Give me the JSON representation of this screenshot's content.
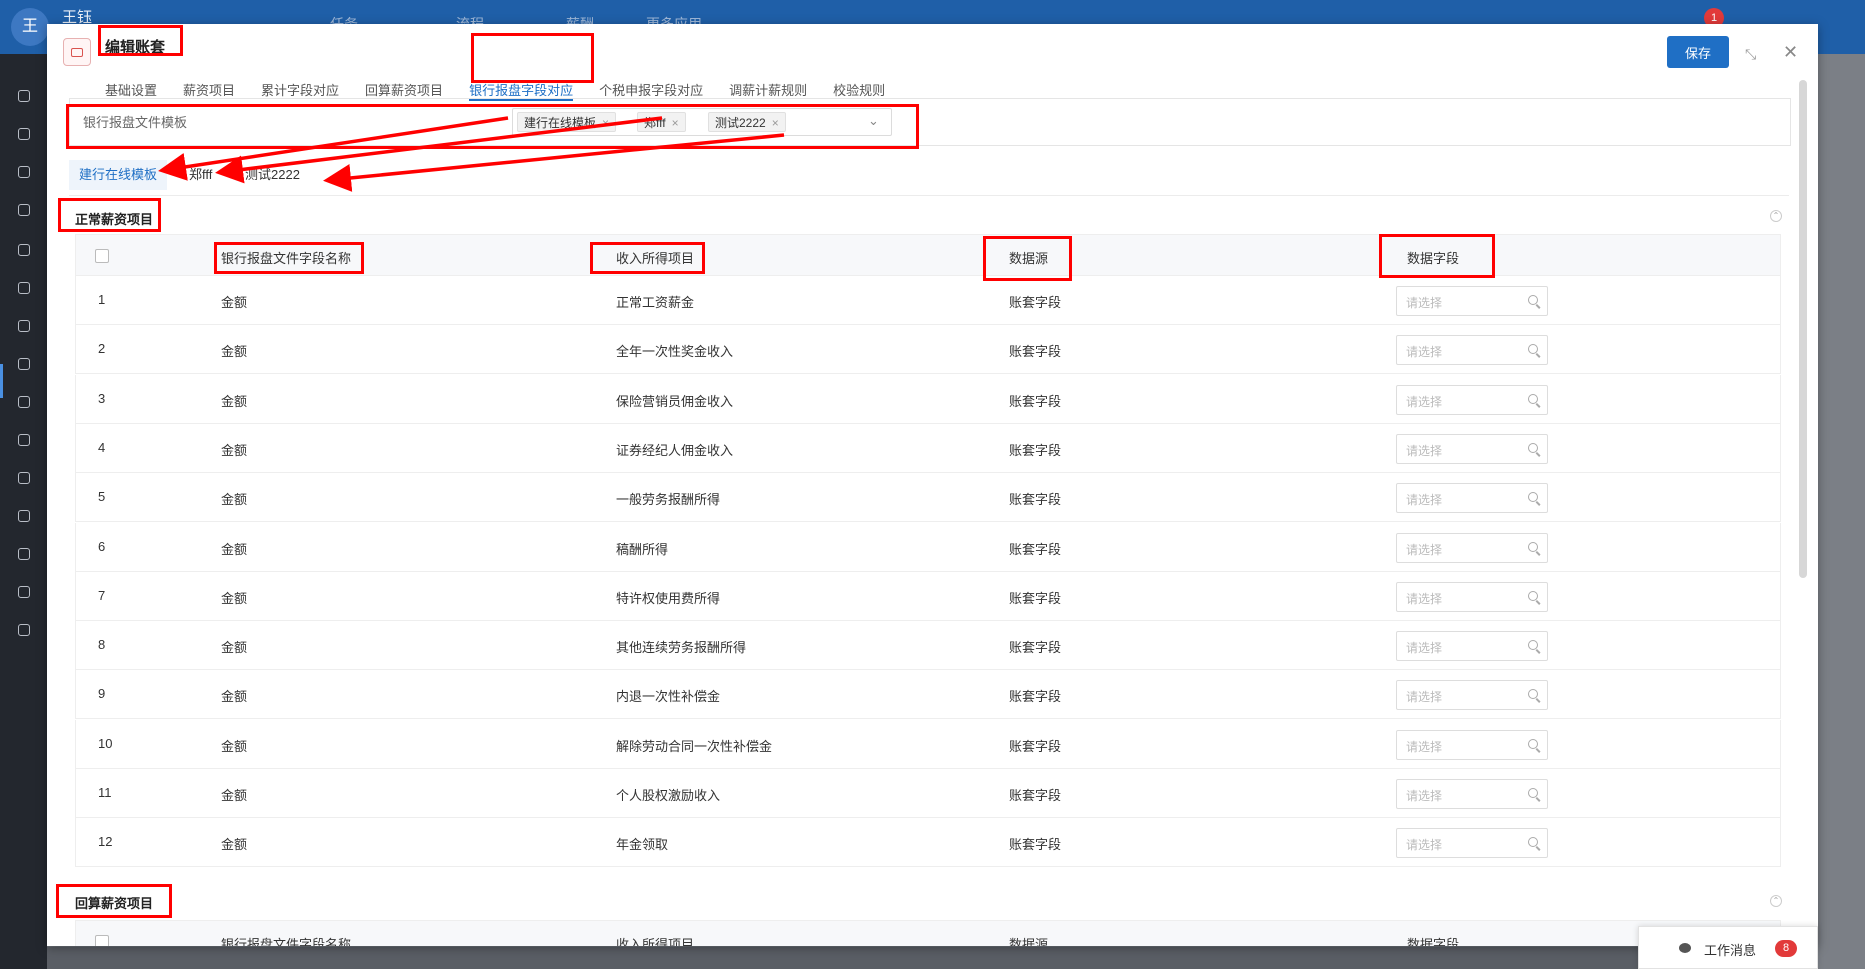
{
  "app": {
    "user_initial": "王",
    "user_name": "王钰",
    "notification_count": "1",
    "bg_tabs": [
      "任务",
      "流程",
      "薪酬",
      "更多应用"
    ]
  },
  "modal": {
    "title": "编辑账套",
    "save_label": "保存",
    "tabs": [
      {
        "label": "基础设置"
      },
      {
        "label": "薪资项目"
      },
      {
        "label": "累计字段对应"
      },
      {
        "label": "回算薪资项目"
      },
      {
        "label": "银行报盘字段对应",
        "active": true
      },
      {
        "label": "个税申报字段对应"
      },
      {
        "label": "调薪计薪规则"
      },
      {
        "label": "校验规则"
      }
    ]
  },
  "template_select": {
    "label": "银行报盘文件模板",
    "chips": [
      "建行在线模板",
      "郑fff",
      "测试2222"
    ]
  },
  "sub_tabs": [
    "建行在线模板",
    "郑fff",
    "测试2222"
  ],
  "normal_section": {
    "title": "正常薪资项目",
    "headers": {
      "field_name": "银行报盘文件字段名称",
      "income_item": "收入所得项目",
      "data_source": "数据源",
      "data_field": "数据字段"
    },
    "placeholder": "请选择",
    "rows": [
      {
        "no": "1",
        "name": "金额",
        "income": "正常工资薪金",
        "source": "账套字段"
      },
      {
        "no": "2",
        "name": "金额",
        "income": "全年一次性奖金收入",
        "source": "账套字段"
      },
      {
        "no": "3",
        "name": "金额",
        "income": "保险营销员佣金收入",
        "source": "账套字段"
      },
      {
        "no": "4",
        "name": "金额",
        "income": "证券经纪人佣金收入",
        "source": "账套字段"
      },
      {
        "no": "5",
        "name": "金额",
        "income": "一般劳务报酬所得",
        "source": "账套字段"
      },
      {
        "no": "6",
        "name": "金额",
        "income": "稿酬所得",
        "source": "账套字段"
      },
      {
        "no": "7",
        "name": "金额",
        "income": "特许权使用费所得",
        "source": "账套字段"
      },
      {
        "no": "8",
        "name": "金额",
        "income": "其他连续劳务报酬所得",
        "source": "账套字段"
      },
      {
        "no": "9",
        "name": "金额",
        "income": "内退一次性补偿金",
        "source": "账套字段"
      },
      {
        "no": "10",
        "name": "金额",
        "income": "解除劳动合同一次性补偿金",
        "source": "账套字段"
      },
      {
        "no": "11",
        "name": "金额",
        "income": "个人股权激励收入",
        "source": "账套字段"
      },
      {
        "no": "12",
        "name": "金额",
        "income": "年金领取",
        "source": "账套字段"
      }
    ]
  },
  "recalc_section": {
    "title": "回算薪资项目",
    "headers": {
      "field_name": "银行报盘文件字段名称",
      "income_item": "收入所得项目",
      "data_source": "数据源",
      "data_field": "数据字段"
    }
  },
  "work_msg": {
    "label": "工作消息",
    "count": "8"
  },
  "colors": {
    "primary": "#1f6fc5",
    "annotation": "#ff0000",
    "topbar": "#1f5fa8"
  }
}
